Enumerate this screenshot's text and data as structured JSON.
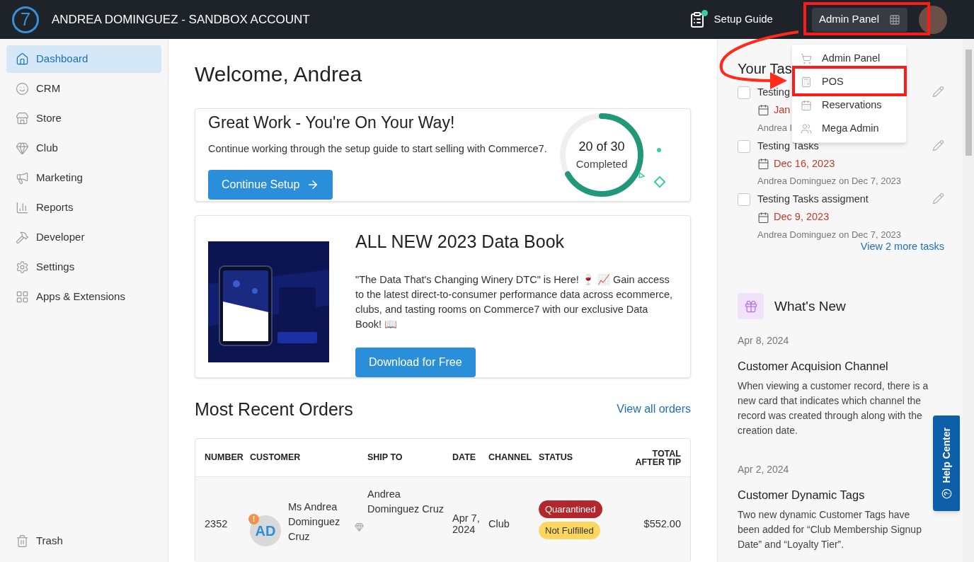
{
  "header": {
    "logo_text": "7",
    "account": "ANDREA DOMINGUEZ - SANDBOX ACCOUNT",
    "setup_guide": {
      "label": "Setup Guide",
      "notification": true
    },
    "admin_panel": "Admin Panel"
  },
  "sidebar": {
    "items": [
      {
        "label": "Dashboard",
        "selected": true
      },
      {
        "label": "CRM",
        "selected": false
      },
      {
        "label": "Store",
        "selected": false
      },
      {
        "label": "Club",
        "selected": false
      },
      {
        "label": "Marketing",
        "selected": false
      },
      {
        "label": "Reports",
        "selected": false
      },
      {
        "label": "Developer",
        "selected": false
      },
      {
        "label": "Settings",
        "selected": false
      },
      {
        "label": "Apps & Extensions",
        "selected": false
      }
    ],
    "trash": "Trash"
  },
  "main": {
    "greeting": "Welcome, Andrea",
    "setup_card": {
      "title": "Great Work - You're On Your Way!",
      "text": "Continue working through the setup guide to start selling with Commerce7.",
      "button": "Continue Setup",
      "progress": {
        "count": "20 of 30",
        "caption": "Completed",
        "level": 0.667
      }
    },
    "promo_card": {
      "title": "ALL NEW 2023 Data Book",
      "text": "\"The Data That's Changing Winery DTC\" is Here! 🍷 📈 Gain access to the latest direct-to-consumer performance data across ecommerce, clubs, and tasting rooms on Commerce7 with our exclusive Data Book! 📖",
      "button": "Download for Free"
    },
    "orders": {
      "title": "Most Recent Orders",
      "link": "View all orders",
      "table": {
        "columns": [
          "NUMBER",
          "CUSTOMER",
          "SHIP TO",
          "DATE",
          "CHANNEL",
          "STATUS",
          "TOTAL AFTER TIP"
        ],
        "rows": [
          {
            "number": "2352",
            "initials": "AD",
            "alert": "!",
            "customer": "Ms Andrea Dominguez Cruz",
            "club_member": true,
            "ship_to": "Andrea Dominguez Cruz",
            "date": "Apr 7, 2024",
            "channel": "Club",
            "statuses": [
              {
                "label": "Quarantined",
                "color": "#b3262c"
              },
              {
                "label": "Not Fulfilled",
                "color": "#fcd660"
              }
            ],
            "total": "$552.00"
          }
        ]
      }
    }
  },
  "tasks": {
    "title": "Your Tas",
    "items": [
      {
        "title": "Testing",
        "due": "Jan",
        "meta": "Andrea I",
        "checked": false
      },
      {
        "title": "Testing Tasks",
        "due": "Dec 16, 2023",
        "meta": "Andrea Dominguez on Dec 7, 2023",
        "checked": false
      },
      {
        "title": "Testing Tasks assigment",
        "due": "Dec 9, 2023",
        "meta": "Andrea Dominguez on Dec 7, 2023",
        "checked": false
      }
    ],
    "more_link": "View 2 more tasks"
  },
  "whats_new": {
    "title": "What's New",
    "entries": [
      {
        "date": "Apr 8, 2024",
        "title": "Customer Acquision Channel",
        "text": "When viewing a customer record, there is a new card that indicates which channel the record was created through along with the creation date."
      },
      {
        "date": "Apr 2, 2024",
        "title": "Customer Dynamic Tags",
        "text": "Two new dynamic Customer Tags have been added for “Club Membership Signup Date” and “Loyalty Tier”."
      }
    ]
  },
  "help_center": "Help Center",
  "admin_menu": {
    "items": [
      {
        "label": "Admin Panel"
      },
      {
        "label": "POS"
      },
      {
        "label": "Reservations"
      },
      {
        "label": "Mega Admin"
      }
    ]
  }
}
